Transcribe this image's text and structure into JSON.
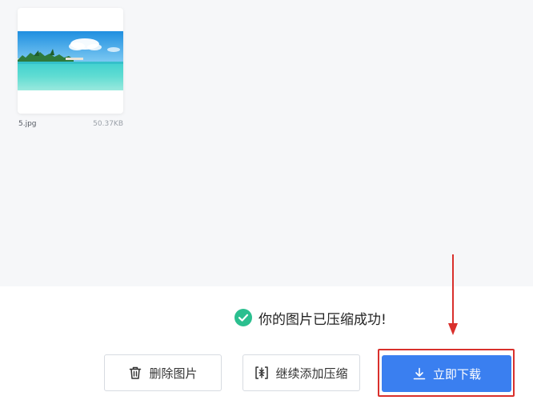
{
  "file": {
    "name": "5.jpg",
    "size": "50.37KB"
  },
  "status": {
    "message": "你的图片已压缩成功!"
  },
  "actions": {
    "delete_label": "删除图片",
    "continue_label": "继续添加压缩",
    "download_label": "立即下载"
  },
  "colors": {
    "primary": "#3a7ff0",
    "success": "#2bbf8f",
    "highlight": "#d9302c"
  },
  "icons": {
    "success": "check-circle-icon",
    "delete": "trash-icon",
    "continue": "compress-icon",
    "download": "download-icon"
  }
}
